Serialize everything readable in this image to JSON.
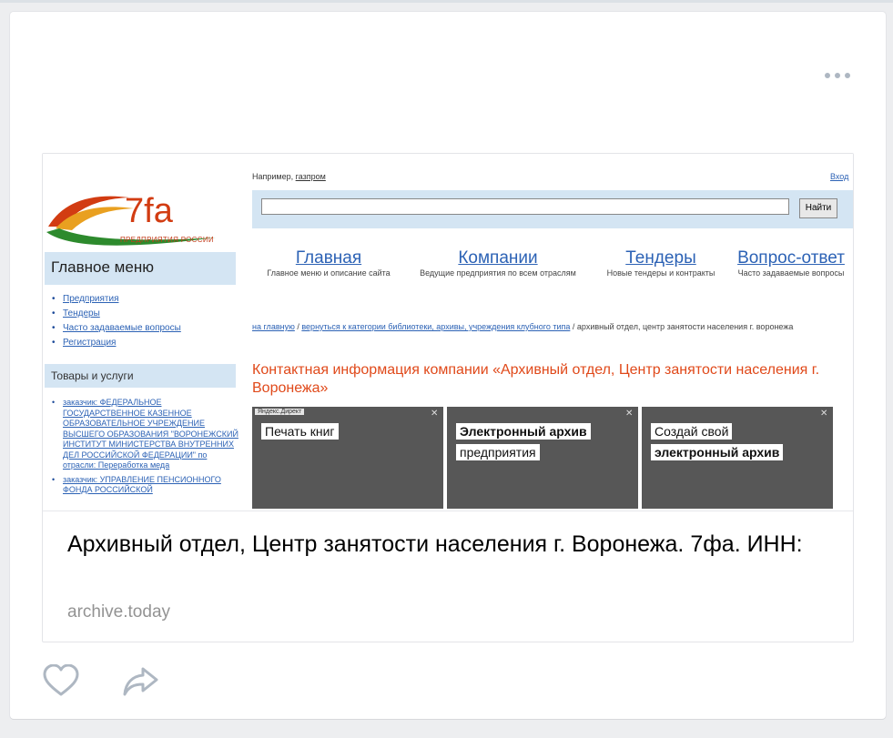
{
  "post": {
    "more_icon": "more-horizontal-icon"
  },
  "snippet": {
    "title": "Архивный отдел, Центр занятости населения г. Воронежа. 7фа. ИНН:",
    "domain": "archive.today"
  },
  "site": {
    "logo_text": "7fa",
    "logo_sub": "ПРЕДПРИЯТИЯ РОССИИ",
    "main_menu_title": "Главное меню",
    "main_menu_items": [
      "Предприятия",
      "Тендеры",
      "Часто задаваемые вопросы",
      "Регистрация"
    ],
    "goods_title": "Товары и услуги",
    "goods_items": [
      "заказчик: ФЕДЕРАЛЬНОЕ ГОСУДАРСТВЕННОЕ КАЗЕННОЕ ОБРАЗОВАТЕЛЬНОЕ УЧРЕЖДЕНИЕ ВЫСШЕГО ОБРАЗОВАНИЯ \"ВОРОНЕЖСКИЙ ИНСТИТУТ МИНИСТЕРСТВА ВНУТРЕННИХ ДЕЛ РОССИЙСКОЙ ФЕДЕРАЦИИ\" по отрасли: Переработка меда",
      "заказчик: УПРАВЛЕНИЕ ПЕНСИОННОГО ФОНДА РОССИЙСКОЙ"
    ],
    "example_label": "Например,",
    "example_value": "газпром",
    "login": "Вход",
    "search_button": "Найти",
    "nav": [
      {
        "title": "Главная",
        "desc": "Главное меню и описание сайта"
      },
      {
        "title": "Компании",
        "desc": "Ведущие предприятия по всем отраслям"
      },
      {
        "title": "Тендеры",
        "desc": "Новые тендеры и контракты"
      },
      {
        "title": "Вопрос-ответ",
        "desc": "Часто задаваемые вопросы"
      }
    ],
    "crumb_home": "на главную",
    "crumb_sep": "/",
    "crumb_back": "вернуться к категории библиотеки, архивы, учреждения клубного типа",
    "crumb_current": "архивный отдел, центр занятости населения г. воронежа",
    "contact_heading": "Контактная информация компании «Архивный отдел, Центр занятости населения г. Воронежа»",
    "ads_tag": "Яндекс.Директ",
    "ads": [
      {
        "line1": "Печать книг",
        "line2": ""
      },
      {
        "line1": "Электронный архив",
        "line2": "предприятия"
      },
      {
        "line1": "Создай свой",
        "line2": "электронный архив"
      }
    ]
  },
  "actions": {
    "like_icon": "heart-icon",
    "share_icon": "share-arrow-icon"
  },
  "colors": {
    "page_bg": "#edeef0",
    "link_blue": "#2c62b5",
    "site_accent": "#e0491a",
    "icon_gray": "#aeb7c2"
  }
}
